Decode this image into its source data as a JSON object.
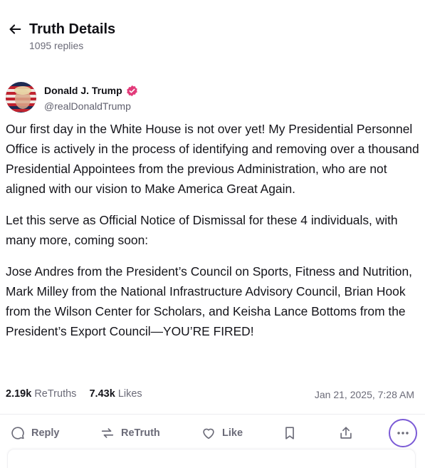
{
  "header": {
    "title": "Truth Details",
    "replies": "1095 replies"
  },
  "post": {
    "author_name": "Donald J. Trump",
    "author_handle": "@realDonaldTrump",
    "verified_color": "#e23b7a",
    "paragraphs": [
      "Our first day in the White House is not over yet! My Presidential Personnel Office is actively in the process of identifying and removing over a thousand Presidential Appointees from the previous Administration, who are not aligned with our vision to Make America Great Again.",
      "Let this serve as Official Notice of Dismissal for these 4 individuals, with many more, coming soon:",
      "Jose Andres from the President’s Council on Sports, Fitness and Nutrition, Mark Milley from the National Infrastructure Advisory Council, Brian Hook from the Wilson Center for Scholars, and Keisha Lance Bottoms from the President’s Export Council—YOU’RE FIRED!"
    ],
    "stats": {
      "retruths_count": "2.19k",
      "retruths_label": "ReTruths",
      "likes_count": "7.43k",
      "likes_label": "Likes"
    },
    "timestamp": "Jan 21, 2025, 7:28 AM"
  },
  "actions": {
    "reply": "Reply",
    "retruth": "ReTruth",
    "like": "Like",
    "icons": [
      "reply-icon",
      "retruth-icon",
      "like-icon",
      "bookmark-icon",
      "share-icon",
      "more-icon"
    ]
  },
  "colors": {
    "accent": "#7b5bd6",
    "muted": "#6b6b78"
  }
}
